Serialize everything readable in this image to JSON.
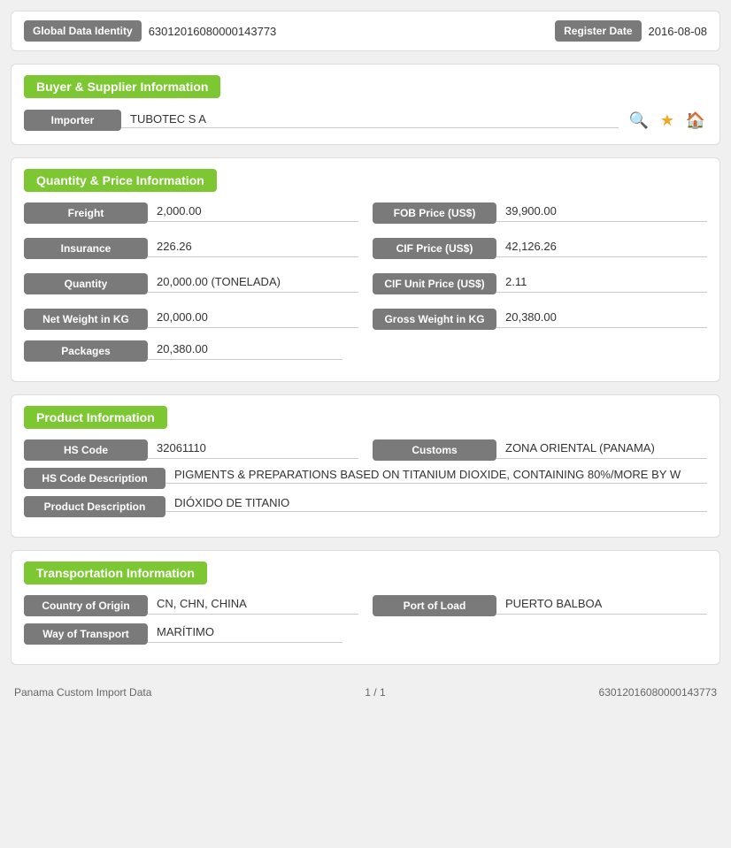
{
  "topCard": {
    "globalDataIdentityLabel": "Global Data Identity",
    "globalDataIdentityValue": "63012016080000143773",
    "registerDateLabel": "Register Date",
    "registerDateValue": "2016-08-08"
  },
  "buyerSupplier": {
    "sectionTitle": "Buyer & Supplier Information",
    "importerLabel": "Importer",
    "importerValue": "TUBOTEC S A"
  },
  "quantityPrice": {
    "sectionTitle": "Quantity & Price Information",
    "freightLabel": "Freight",
    "freightValue": "2,000.00",
    "fobPriceLabel": "FOB Price (US$)",
    "fobPriceValue": "39,900.00",
    "insuranceLabel": "Insurance",
    "insuranceValue": "226.26",
    "cifPriceLabel": "CIF Price (US$)",
    "cifPriceValue": "42,126.26",
    "quantityLabel": "Quantity",
    "quantityValue": "20,000.00 (TONELADA)",
    "cifUnitPriceLabel": "CIF Unit Price (US$)",
    "cifUnitPriceValue": "2.11",
    "netWeightLabel": "Net Weight in KG",
    "netWeightValue": "20,000.00",
    "grossWeightLabel": "Gross Weight in KG",
    "grossWeightValue": "20,380.00",
    "packagesLabel": "Packages",
    "packagesValue": "20,380.00"
  },
  "productInfo": {
    "sectionTitle": "Product Information",
    "hsCodeLabel": "HS Code",
    "hsCodeValue": "32061110",
    "customsLabel": "Customs",
    "customsValue": "ZONA ORIENTAL (PANAMA)",
    "hsCodeDescriptionLabel": "HS Code Description",
    "hsCodeDescriptionValue": "PIGMENTS & PREPARATIONS BASED ON TITANIUM DIOXIDE, CONTAINING 80%/MORE BY W",
    "productDescriptionLabel": "Product Description",
    "productDescriptionValue": "DIÓXIDO DE TITANIO"
  },
  "transportation": {
    "sectionTitle": "Transportation Information",
    "countryOfOriginLabel": "Country of Origin",
    "countryOfOriginValue": "CN, CHN, CHINA",
    "portOfLoadLabel": "Port of Load",
    "portOfLoadValue": "PUERTO BALBOA",
    "wayOfTransportLabel": "Way of Transport",
    "wayOfTransportValue": "MARÍTIMO"
  },
  "footer": {
    "leftText": "Panama Custom Import Data",
    "centerText": "1 / 1",
    "rightText": "63012016080000143773"
  }
}
